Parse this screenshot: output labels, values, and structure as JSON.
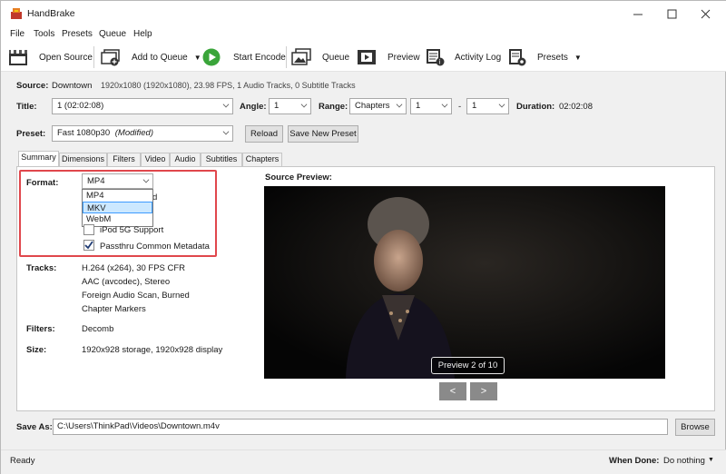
{
  "window": {
    "title": "HandBrake"
  },
  "menu": [
    "File",
    "Tools",
    "Presets",
    "Queue",
    "Help"
  ],
  "toolbar": {
    "open_source": "Open Source",
    "add_to_queue": "Add to Queue",
    "start_encode": "Start Encode",
    "queue": "Queue",
    "preview": "Preview",
    "activity_log": "Activity Log",
    "presets": "Presets"
  },
  "source": {
    "label": "Source:",
    "name": "Downtown",
    "info": "1920x1080 (1920x1080), 23.98 FPS, 1 Audio Tracks, 0 Subtitle Tracks"
  },
  "title_row": {
    "title_label": "Title:",
    "title_value": "1 (02:02:08)",
    "angle_label": "Angle:",
    "angle_value": "1",
    "range_label": "Range:",
    "range_value": "Chapters",
    "range_start": "1",
    "range_sep": "-",
    "range_end": "1",
    "duration_label": "Duration:",
    "duration_value": "02:02:08"
  },
  "preset": {
    "label": "Preset:",
    "name": "Fast 1080p30",
    "modified": "(Modified)",
    "reload": "Reload",
    "save_new": "Save New Preset"
  },
  "tabs": [
    "Summary",
    "Dimensions",
    "Filters",
    "Video",
    "Audio",
    "Subtitles",
    "Chapters"
  ],
  "summary": {
    "format_label": "Format:",
    "format_value": "MP4",
    "format_options": [
      "MP4",
      "MKV",
      "WebM"
    ],
    "format_highlighted": "MKV",
    "partial_option": "d",
    "ipod_support": "iPod 5G Support",
    "passthru_metadata": "Passthru Common Metadata",
    "tracks_label": "Tracks:",
    "tracks": [
      "H.264 (x264), 30 FPS CFR",
      "AAC (avcodec), Stereo",
      "Foreign Audio Scan, Burned",
      "Chapter Markers"
    ],
    "filters_label": "Filters:",
    "filters_value": "Decomb",
    "size_label": "Size:",
    "size_value": "1920x928 storage, 1920x928 display",
    "source_preview_label": "Source Preview:",
    "preview_counter": "Preview 2 of 10",
    "prev_symbol": "<",
    "next_symbol": ">"
  },
  "save_as": {
    "label": "Save As:",
    "path": "C:\\Users\\ThinkPad\\Videos\\Downtown.m4v",
    "browse": "Browse"
  },
  "status": {
    "text": "Ready",
    "when_done_label": "When Done:",
    "when_done_value": "Do nothing"
  },
  "colors": {
    "highlight_box": "#e0474c",
    "start_green": "#3aa53a",
    "selection": "#cce8ff"
  }
}
